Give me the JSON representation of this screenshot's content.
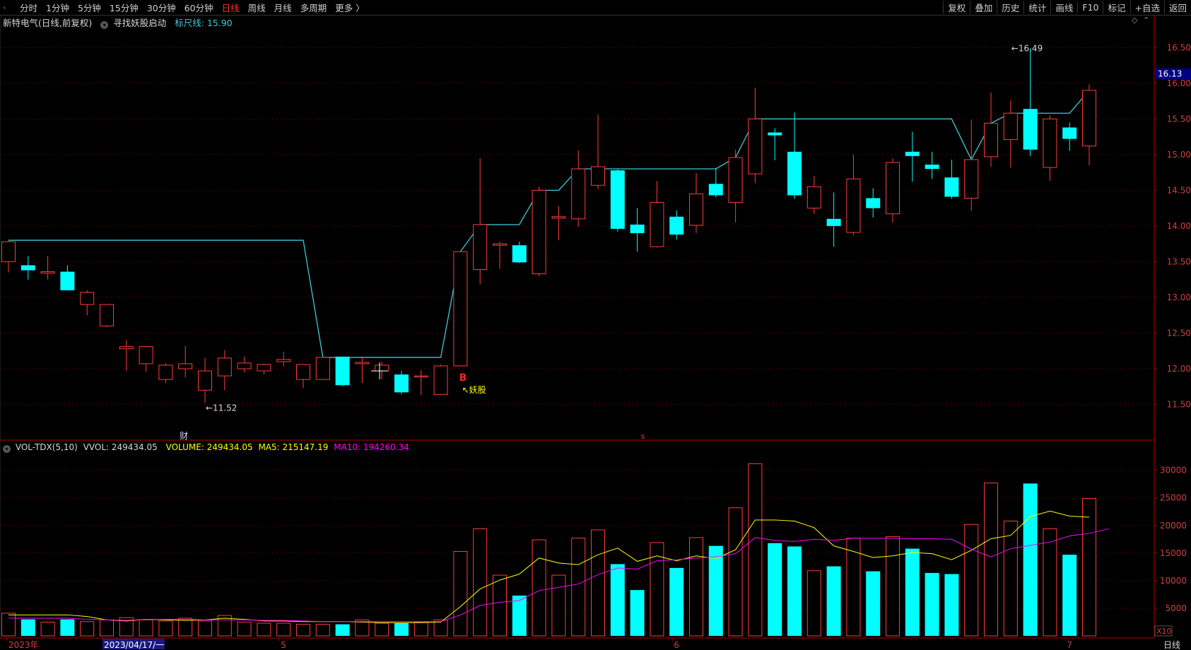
{
  "topbar": {
    "periods": [
      "分时",
      "1分钟",
      "5分钟",
      "15分钟",
      "30分钟",
      "60分钟",
      "日线",
      "周线",
      "月线",
      "多周期",
      "更多 〉"
    ],
    "active_period": "日线",
    "right_items": [
      "复权",
      "叠加",
      "历史",
      "统计",
      "画线",
      "F10",
      "标记",
      "+自选",
      "返回"
    ]
  },
  "header": {
    "stock": "新特电气(日线,前复权)",
    "indicator": "寻找妖股启动",
    "ruler_label": "标尺线:",
    "ruler_value": "15.90"
  },
  "vol_header": {
    "name": "VOL-TDX(5,10)",
    "vvol": "VVOL: 249434.05",
    "volume": "VOLUME: 249434.05",
    "ma5": "MA5: 215147.19",
    "ma10": "MA10: 194260.34"
  },
  "colors": {
    "up": "#ff3c3c",
    "down": "#00ffff",
    "ruler": "#3fc9d8",
    "ma5": "#ffff00",
    "ma10": "#ff00ff",
    "axis": "#b00000",
    "grid": "#5a0000"
  },
  "chart_data": {
    "type": "candlestick",
    "price_axis": {
      "ticks": [
        11.5,
        12.0,
        12.5,
        13.0,
        13.5,
        14.0,
        14.5,
        15.0,
        15.5,
        16.0,
        16.5
      ],
      "ylim": [
        11.0,
        16.75
      ],
      "current_price_label": "16.13"
    },
    "volume_axis": {
      "ticks": [
        5000,
        10000,
        15000,
        20000,
        25000,
        30000
      ],
      "ylim": [
        0,
        32000
      ],
      "unit_label": "X10"
    },
    "x_labels": [
      {
        "index": 0,
        "text": "2023年"
      },
      {
        "index": 5,
        "text": "2023/04/17/一"
      },
      {
        "index": 14,
        "text": "5"
      },
      {
        "index": 34,
        "text": "6"
      },
      {
        "index": 54,
        "text": "7"
      }
    ],
    "bottom_right_label": "日线",
    "annotations": {
      "low": {
        "index": 10,
        "value": 11.52,
        "text": "11.52"
      },
      "high": {
        "index": 51,
        "value": 16.49,
        "text": "16.49"
      },
      "buy_signal": {
        "index": 22,
        "text": "B"
      },
      "yao_label": {
        "index": 22,
        "text": "妖股"
      },
      "fin_marker": {
        "index": 9,
        "text": "财"
      },
      "s_marker": {
        "index": 32,
        "text": "s"
      }
    },
    "candles": [
      {
        "o": 13.5,
        "h": 13.8,
        "l": 13.35,
        "c": 13.78
      },
      {
        "o": 13.45,
        "h": 13.58,
        "l": 13.25,
        "c": 13.38
      },
      {
        "o": 13.34,
        "h": 13.58,
        "l": 13.25,
        "c": 13.36
      },
      {
        "o": 13.36,
        "h": 13.45,
        "l": 13.1,
        "c": 13.1
      },
      {
        "o": 12.9,
        "h": 13.1,
        "l": 12.75,
        "c": 13.07
      },
      {
        "o": 12.6,
        "h": 12.9,
        "l": 12.58,
        "c": 12.9
      },
      {
        "o": 12.28,
        "h": 12.4,
        "l": 11.97,
        "c": 12.31
      },
      {
        "o": 12.07,
        "h": 12.32,
        "l": 11.96,
        "c": 12.31
      },
      {
        "o": 11.85,
        "h": 12.08,
        "l": 11.8,
        "c": 12.05
      },
      {
        "o": 12.0,
        "h": 12.32,
        "l": 11.88,
        "c": 12.07
      },
      {
        "o": 11.7,
        "h": 12.15,
        "l": 11.52,
        "c": 11.97
      },
      {
        "o": 11.9,
        "h": 12.26,
        "l": 11.7,
        "c": 12.15
      },
      {
        "o": 12.0,
        "h": 12.17,
        "l": 11.95,
        "c": 12.08
      },
      {
        "o": 11.97,
        "h": 12.07,
        "l": 11.92,
        "c": 12.06
      },
      {
        "o": 12.1,
        "h": 12.24,
        "l": 12.03,
        "c": 12.13
      },
      {
        "o": 11.85,
        "h": 12.06,
        "l": 11.73,
        "c": 12.06
      },
      {
        "o": 11.85,
        "h": 12.16,
        "l": 11.85,
        "c": 12.16
      },
      {
        "o": 12.17,
        "h": 12.17,
        "l": 11.76,
        "c": 11.77
      },
      {
        "o": 12.07,
        "h": 12.16,
        "l": 11.8,
        "c": 12.09
      },
      {
        "o": 11.97,
        "h": 12.1,
        "l": 11.85,
        "c": 12.05
      },
      {
        "o": 11.92,
        "h": 11.97,
        "l": 11.64,
        "c": 11.67
      },
      {
        "o": 11.89,
        "h": 11.98,
        "l": 11.63,
        "c": 11.9
      },
      {
        "o": 11.64,
        "h": 12.06,
        "l": 11.64,
        "c": 12.04
      },
      {
        "o": 12.04,
        "h": 13.64,
        "l": 12.03,
        "c": 13.64
      },
      {
        "o": 13.39,
        "h": 14.95,
        "l": 13.18,
        "c": 14.02
      },
      {
        "o": 13.73,
        "h": 13.78,
        "l": 13.4,
        "c": 13.75
      },
      {
        "o": 13.73,
        "h": 13.78,
        "l": 13.48,
        "c": 13.49
      },
      {
        "o": 13.33,
        "h": 14.55,
        "l": 13.3,
        "c": 14.5
      },
      {
        "o": 14.11,
        "h": 14.28,
        "l": 13.8,
        "c": 14.13
      },
      {
        "o": 14.1,
        "h": 15.06,
        "l": 13.99,
        "c": 14.8
      },
      {
        "o": 14.57,
        "h": 15.56,
        "l": 14.52,
        "c": 14.83
      },
      {
        "o": 14.78,
        "h": 14.8,
        "l": 13.92,
        "c": 13.96
      },
      {
        "o": 14.02,
        "h": 14.25,
        "l": 13.64,
        "c": 13.9
      },
      {
        "o": 13.71,
        "h": 14.63,
        "l": 13.7,
        "c": 14.33
      },
      {
        "o": 14.13,
        "h": 14.22,
        "l": 13.81,
        "c": 13.88
      },
      {
        "o": 14.01,
        "h": 14.74,
        "l": 13.9,
        "c": 14.45
      },
      {
        "o": 14.59,
        "h": 14.81,
        "l": 14.4,
        "c": 14.43
      },
      {
        "o": 14.33,
        "h": 15.07,
        "l": 14.05,
        "c": 14.96
      },
      {
        "o": 14.73,
        "h": 15.94,
        "l": 14.6,
        "c": 15.5
      },
      {
        "o": 15.31,
        "h": 15.37,
        "l": 14.92,
        "c": 15.27
      },
      {
        "o": 15.04,
        "h": 15.59,
        "l": 14.38,
        "c": 14.43
      },
      {
        "o": 14.25,
        "h": 14.7,
        "l": 14.17,
        "c": 14.55
      },
      {
        "o": 14.1,
        "h": 14.47,
        "l": 13.71,
        "c": 14.0
      },
      {
        "o": 13.91,
        "h": 15.0,
        "l": 13.87,
        "c": 14.66
      },
      {
        "o": 14.39,
        "h": 14.53,
        "l": 14.12,
        "c": 14.25
      },
      {
        "o": 14.17,
        "h": 14.95,
        "l": 14.05,
        "c": 14.89
      },
      {
        "o": 15.04,
        "h": 15.32,
        "l": 14.62,
        "c": 14.98
      },
      {
        "o": 14.86,
        "h": 15.04,
        "l": 14.66,
        "c": 14.8
      },
      {
        "o": 14.68,
        "h": 14.93,
        "l": 14.38,
        "c": 14.41
      },
      {
        "o": 14.39,
        "h": 15.49,
        "l": 14.21,
        "c": 14.93
      },
      {
        "o": 14.97,
        "h": 15.87,
        "l": 14.83,
        "c": 15.44
      },
      {
        "o": 15.21,
        "h": 15.76,
        "l": 14.82,
        "c": 15.58
      },
      {
        "o": 15.64,
        "h": 16.49,
        "l": 14.98,
        "c": 15.07
      },
      {
        "o": 14.82,
        "h": 15.55,
        "l": 14.63,
        "c": 15.5
      },
      {
        "o": 15.38,
        "h": 15.45,
        "l": 15.05,
        "c": 15.22
      },
      {
        "o": 15.12,
        "h": 15.98,
        "l": 14.85,
        "c": 15.9
      }
    ],
    "ruler_line": [
      13.8,
      13.8,
      13.8,
      13.8,
      13.8,
      13.8,
      13.8,
      13.8,
      13.8,
      13.8,
      13.8,
      13.8,
      13.8,
      13.8,
      13.8,
      13.8,
      12.16,
      12.16,
      12.16,
      12.16,
      12.16,
      12.16,
      12.16,
      13.64,
      14.02,
      14.02,
      14.02,
      14.5,
      14.5,
      14.8,
      14.8,
      14.8,
      14.8,
      14.8,
      14.8,
      14.8,
      14.8,
      14.96,
      15.5,
      15.5,
      15.5,
      15.5,
      15.5,
      15.5,
      15.5,
      15.5,
      15.5,
      15.5,
      15.5,
      14.93,
      15.44,
      15.58,
      15.58,
      15.58,
      15.58,
      15.9
    ],
    "volume": [
      4100,
      3000,
      2500,
      3000,
      2600,
      2900,
      3300,
      2900,
      2700,
      3200,
      2700,
      3700,
      2500,
      2300,
      2300,
      2100,
      2100,
      2100,
      2900,
      2300,
      2300,
      2500,
      2900,
      15300,
      19400,
      11000,
      7300,
      17400,
      11000,
      17700,
      19200,
      13000,
      8300,
      16900,
      12300,
      17800,
      16300,
      23200,
      31200,
      16800,
      16200,
      11800,
      12600,
      17700,
      11700,
      18000,
      15800,
      11400,
      11200,
      20200,
      27700,
      20800,
      27600,
      19400,
      14700,
      24900
    ],
    "ma5": [
      3800,
      3800,
      3800,
      3800,
      3500,
      2900,
      2700,
      3000,
      2900,
      2800,
      2900,
      3200,
      3000,
      2700,
      2700,
      2600,
      2600,
      2600,
      2500,
      2400,
      2400,
      2400,
      2500,
      5300,
      8500,
      10100,
      11200,
      14100,
      13200,
      12900,
      14700,
      15900,
      13500,
      14500,
      13600,
      14500,
      14000,
      15600,
      21000,
      21000,
      20800,
      19600,
      16300,
      15300,
      14200,
      14500,
      15100,
      14900,
      13800,
      15500,
      17600,
      18200,
      21600,
      22600,
      21700,
      21500
    ],
    "ma10": [
      3200,
      3200,
      3200,
      3200,
      3000,
      2900,
      2800,
      3000,
      3000,
      3000,
      2900,
      2900,
      2900,
      2800,
      2800,
      2700,
      2600,
      2600,
      2600,
      2600,
      2600,
      2600,
      2600,
      3800,
      5500,
      6100,
      6400,
      8200,
      8800,
      9400,
      11100,
      12300,
      12100,
      13600,
      13800,
      14100,
      14300,
      14900,
      17800,
      17300,
      17100,
      17500,
      17300,
      17700,
      17700,
      17700,
      17600,
      17600,
      17500,
      15700,
      14300,
      15800,
      16400,
      17000,
      18100,
      18600,
      19400
    ]
  }
}
